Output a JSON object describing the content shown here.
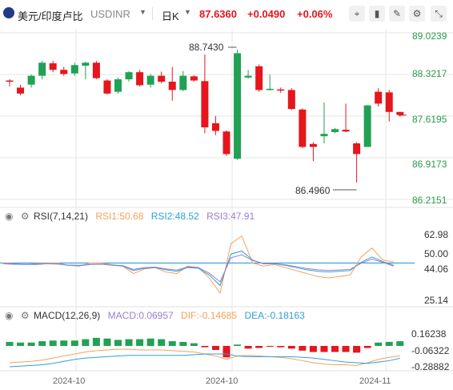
{
  "header": {
    "symbol_name": "美元/印度卢比",
    "symbol_code": "USDINR",
    "dropdown_icon": "caret-down-icon",
    "period": "日K",
    "last": "87.6360",
    "change": "+0.0490",
    "change_pct": "+0.06%",
    "tools": [
      "crosshair-icon",
      "candle-type-icon",
      "draw-icon",
      "settings-icon",
      "collapse-icon",
      "close-icon"
    ]
  },
  "colors": {
    "up": "#e5161d",
    "down": "#21a153",
    "price_axis": "#2a9a4a",
    "ma1": "#f5a15a",
    "ma2": "#2ea0d8",
    "ma3": "#9b7fd0",
    "grid": "#e6e6e6"
  },
  "chart_data": [
    {
      "type": "candlestick",
      "y_ticks": [
        "89.0239",
        "88.3217",
        "87.6195",
        "86.9173",
        "86.2151"
      ],
      "ylim": [
        86.2151,
        89.0239
      ],
      "annotations": {
        "high": "88.7430",
        "low": "86.4960"
      },
      "candles": [
        {
          "o": 88.22,
          "h": 88.24,
          "l": 88.12,
          "c": 88.2
        },
        {
          "o": 88.1,
          "h": 88.15,
          "l": 87.97,
          "c": 88.0
        },
        {
          "o": 88.15,
          "h": 88.32,
          "l": 88.1,
          "c": 88.3
        },
        {
          "o": 88.3,
          "h": 88.55,
          "l": 88.24,
          "c": 88.52
        },
        {
          "o": 88.51,
          "h": 88.55,
          "l": 88.36,
          "c": 88.4
        },
        {
          "o": 88.4,
          "h": 88.45,
          "l": 88.3,
          "c": 88.33
        },
        {
          "o": 88.34,
          "h": 88.52,
          "l": 88.3,
          "c": 88.48
        },
        {
          "o": 88.47,
          "h": 88.54,
          "l": 88.24,
          "c": 88.52
        },
        {
          "o": 88.52,
          "h": 88.55,
          "l": 88.24,
          "c": 88.26
        },
        {
          "o": 88.22,
          "h": 88.24,
          "l": 87.98,
          "c": 88.0
        },
        {
          "o": 88.03,
          "h": 88.27,
          "l": 88.0,
          "c": 88.24
        },
        {
          "o": 88.24,
          "h": 88.38,
          "l": 88.2,
          "c": 88.36
        },
        {
          "o": 88.36,
          "h": 88.4,
          "l": 88.12,
          "c": 88.14
        },
        {
          "o": 88.15,
          "h": 88.33,
          "l": 88.1,
          "c": 88.3
        },
        {
          "o": 88.3,
          "h": 88.37,
          "l": 88.17,
          "c": 88.2
        },
        {
          "o": 88.2,
          "h": 88.45,
          "l": 87.88,
          "c": 88.06
        },
        {
          "o": 88.06,
          "h": 88.38,
          "l": 88.04,
          "c": 88.3
        },
        {
          "o": 88.29,
          "h": 88.31,
          "l": 88.2,
          "c": 88.22
        },
        {
          "o": 88.21,
          "h": 88.66,
          "l": 87.33,
          "c": 87.43
        },
        {
          "o": 87.5,
          "h": 87.62,
          "l": 87.3,
          "c": 87.37
        },
        {
          "o": 87.36,
          "h": 87.38,
          "l": 86.95,
          "c": 86.98
        },
        {
          "o": 86.9,
          "h": 88.74,
          "l": 86.88,
          "c": 88.68
        },
        {
          "o": 88.27,
          "h": 88.4,
          "l": 88.25,
          "c": 88.3
        },
        {
          "o": 88.46,
          "h": 88.49,
          "l": 88.03,
          "c": 88.06
        },
        {
          "o": 88.07,
          "h": 88.32,
          "l": 88.05,
          "c": 88.08
        },
        {
          "o": 88.07,
          "h": 88.1,
          "l": 88.01,
          "c": 88.05
        },
        {
          "o": 88.06,
          "h": 88.09,
          "l": 87.72,
          "c": 87.74
        },
        {
          "o": 87.73,
          "h": 87.75,
          "l": 87.08,
          "c": 87.1
        },
        {
          "o": 87.15,
          "h": 87.18,
          "l": 86.86,
          "c": 87.1
        },
        {
          "o": 87.28,
          "h": 87.85,
          "l": 87.16,
          "c": 87.32
        },
        {
          "o": 87.35,
          "h": 87.42,
          "l": 87.33,
          "c": 87.4
        },
        {
          "o": 87.39,
          "h": 87.83,
          "l": 87.35,
          "c": 87.36
        },
        {
          "o": 87.16,
          "h": 87.18,
          "l": 86.5,
          "c": 86.98
        },
        {
          "o": 87.1,
          "h": 87.81,
          "l": 87.1,
          "c": 87.8
        },
        {
          "o": 88.03,
          "h": 88.09,
          "l": 87.78,
          "c": 87.83
        },
        {
          "o": 88.02,
          "h": 88.06,
          "l": 87.53,
          "c": 87.69
        },
        {
          "o": 87.69,
          "h": 87.69,
          "l": 87.61,
          "c": 87.64
        }
      ]
    },
    {
      "type": "line",
      "name": "RSI",
      "header": {
        "title": "RSI(7,14,21)",
        "rsi1": "RSI1:50.68",
        "rsi2": "RSI2:48.52",
        "rsi3": "RSI3:47.91"
      },
      "y_ticks": [
        "62.98",
        "50.00",
        "44.06",
        "25.14"
      ],
      "ylim": [
        25.14,
        70.0
      ],
      "reference_line": 50.0,
      "series": [
        {
          "name": "RSI1",
          "values": [
            50,
            49.5,
            49,
            49.5,
            50,
            50,
            48.5,
            48,
            50,
            50,
            49,
            48,
            43,
            46,
            47,
            44,
            43,
            48,
            47,
            40,
            30,
            63,
            68,
            50,
            48,
            49,
            47,
            45,
            43,
            41,
            40,
            41,
            42,
            54,
            60,
            52,
            50.68
          ]
        },
        {
          "name": "RSI2",
          "values": [
            49.5,
            49.2,
            49,
            49,
            49.5,
            49.3,
            48.5,
            48.2,
            49,
            49.2,
            48.6,
            48,
            45,
            46.5,
            47,
            45.5,
            44.5,
            47,
            46.5,
            42,
            35,
            56,
            58,
            52,
            49.5,
            49.5,
            48.5,
            47,
            45.5,
            44.5,
            44,
            44.5,
            45,
            50.5,
            54,
            51,
            48.52
          ]
        },
        {
          "name": "RSI3",
          "values": [
            49.6,
            49.4,
            49.2,
            49.2,
            49.6,
            49.5,
            48.7,
            48.5,
            49.2,
            49.3,
            48.8,
            48.3,
            45.8,
            46.9,
            47.3,
            46.1,
            45.3,
            47.4,
            47,
            43.2,
            37.5,
            53.5,
            55.5,
            51.7,
            49.6,
            49.6,
            48.9,
            47.6,
            46.3,
            45.5,
            45.1,
            45.4,
            45.8,
            49.8,
            52.6,
            50.5,
            47.91
          ]
        }
      ]
    },
    {
      "type": "bar",
      "name": "MACD",
      "header": {
        "title": "MACD(12,26,9)",
        "macd": "MACD:0.06957",
        "dif": "DIF:-0.14685",
        "dea": "DEA:-0.18163"
      },
      "y_ticks": [
        "0.16238",
        "-0.06322",
        "-0.28882"
      ],
      "ylim": [
        -0.31,
        0.19
      ],
      "histogram": [
        0.06,
        0.05,
        0.05,
        0.07,
        0.08,
        0.08,
        0.08,
        0.1,
        0.12,
        0.11,
        0.09,
        0.1,
        0.1,
        0.11,
        0.1,
        0.07,
        0.06,
        0.04,
        -0.02,
        -0.06,
        -0.17,
        0.02,
        -0.04,
        -0.03,
        -0.01,
        -0.02,
        -0.04,
        -0.07,
        -0.09,
        -0.09,
        -0.09,
        -0.09,
        -0.1,
        -0.03,
        0.05,
        0.06,
        0.06957
      ],
      "series": [
        {
          "name": "DIF",
          "values": [
            -0.25,
            -0.24,
            -0.23,
            -0.21,
            -0.18,
            -0.15,
            -0.12,
            -0.09,
            -0.07,
            -0.06,
            -0.05,
            -0.05,
            -0.06,
            -0.06,
            -0.06,
            -0.07,
            -0.08,
            -0.09,
            -0.12,
            -0.15,
            -0.2,
            -0.15,
            -0.14,
            -0.15,
            -0.16,
            -0.17,
            -0.19,
            -0.22,
            -0.25,
            -0.27,
            -0.28,
            -0.28,
            -0.29,
            -0.25,
            -0.2,
            -0.17,
            -0.14685
          ]
        },
        {
          "name": "DEA",
          "values": [
            -0.31,
            -0.3,
            -0.29,
            -0.28,
            -0.26,
            -0.23,
            -0.2,
            -0.18,
            -0.17,
            -0.16,
            -0.15,
            -0.14,
            -0.14,
            -0.14,
            -0.14,
            -0.14,
            -0.14,
            -0.13,
            -0.12,
            -0.12,
            -0.12,
            -0.15,
            -0.16,
            -0.16,
            -0.16,
            -0.16,
            -0.16,
            -0.17,
            -0.18,
            -0.2,
            -0.22,
            -0.24,
            -0.25,
            -0.26,
            -0.24,
            -0.22,
            -0.18163
          ]
        }
      ]
    }
  ],
  "x_labels": [
    "2024-10",
    "2024-10",
    "2024-11"
  ]
}
